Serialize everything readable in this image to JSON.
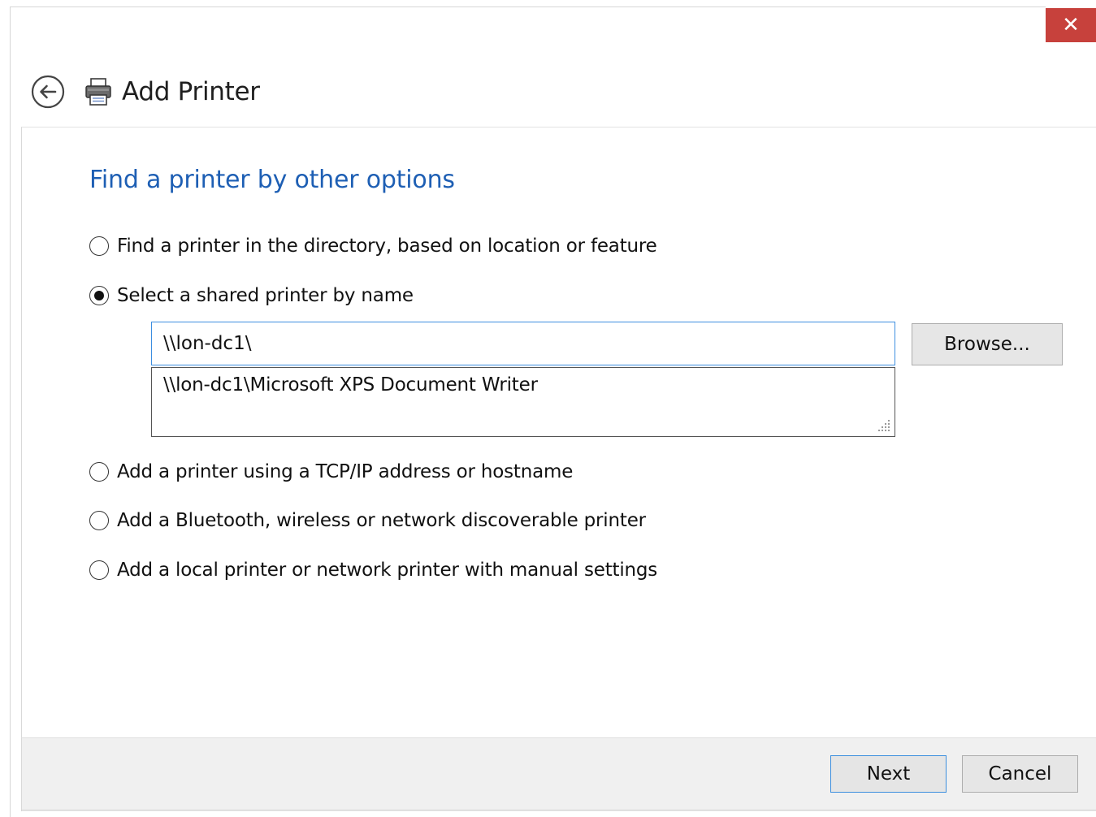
{
  "window": {
    "close_label": "✕",
    "title": "Add Printer",
    "accent_color": "#1e5fb4",
    "close_color": "#c7413c"
  },
  "main": {
    "heading": "Find a printer by other options",
    "options": [
      {
        "label": "Find a printer in the directory, based on location or feature",
        "selected": false
      },
      {
        "label": "Select a shared printer by name",
        "selected": true
      },
      {
        "label": "Add a printer using a TCP/IP address or hostname",
        "selected": false
      },
      {
        "label": "Add a Bluetooth, wireless or network discoverable printer",
        "selected": false
      },
      {
        "label": "Add a local printer or network printer with manual settings",
        "selected": false
      }
    ],
    "printer_name_value": "\\\\lon-dc1\\",
    "suggestion": "\\\\lon-dc1\\Microsoft XPS Document Writer",
    "browse_label": "Browse..."
  },
  "footer": {
    "next_label": "Next",
    "cancel_label": "Cancel"
  }
}
